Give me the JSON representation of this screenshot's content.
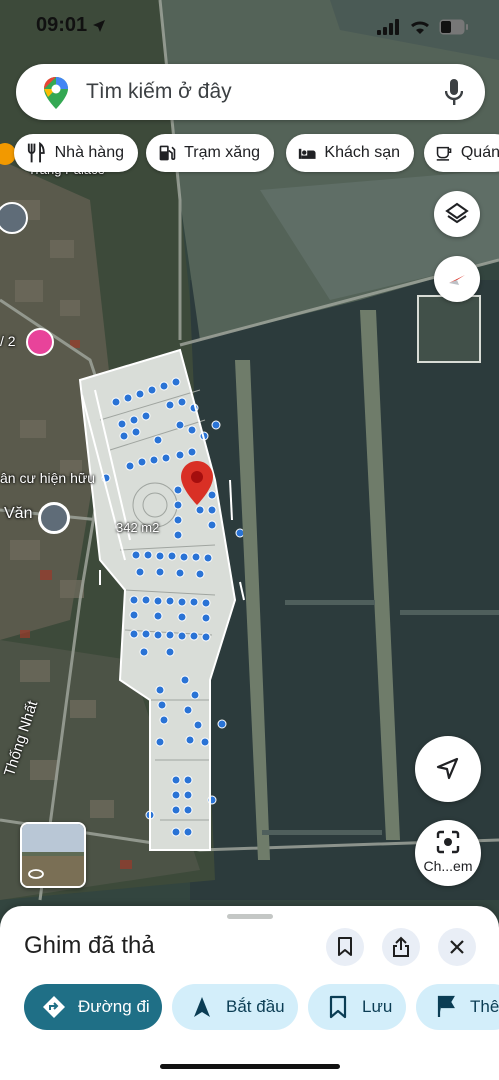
{
  "status_bar": {
    "time": "09:01",
    "icons": [
      "location-arrow-icon",
      "signal-icon",
      "wifi-icon",
      "battery-icon"
    ]
  },
  "search": {
    "placeholder": "Tìm kiếm ở đây",
    "logo": "maps-pin-logo",
    "mic_icon": "mic-icon"
  },
  "chips": [
    {
      "label": "Nhà hàng",
      "icon": "fork-knife-icon"
    },
    {
      "label": "Trạm xăng",
      "icon": "gas-station-icon"
    },
    {
      "label": "Khách sạn",
      "icon": "bed-icon"
    },
    {
      "label": "Quán",
      "icon": "coffee-icon"
    }
  ],
  "map": {
    "labels": {
      "place_1": "Trang Palace",
      "place_2": "ân cư hiện hữu",
      "place_3": "Văn",
      "area_measure": "342 m2",
      "street": "Thống Nhất",
      "place_4": "/ 2"
    },
    "dropped_pin_color": "#d93025"
  },
  "map_controls": {
    "layers_icon": "layers-icon",
    "compass_icon": "compass-icon",
    "location_icon": "my-location-icon",
    "lens_label": "Ch...em",
    "lens_icon": "lens-icon",
    "street_view_icon": "360-icon"
  },
  "sheet": {
    "title": "Ghim đã thả",
    "bookmark_icon": "bookmark-icon",
    "share_icon": "share-icon",
    "close_icon": "close-icon",
    "actions": [
      {
        "label": "Đường đi",
        "icon": "directions-icon",
        "style": "primary"
      },
      {
        "label": "Bắt đầu",
        "icon": "navigation-arrow-icon",
        "style": "secondary"
      },
      {
        "label": "Lưu",
        "icon": "bookmark-icon",
        "style": "secondary"
      },
      {
        "label": "Thêm",
        "icon": "flag-icon",
        "style": "secondary"
      }
    ]
  },
  "colors": {
    "primary_action": "#1f6f86",
    "secondary_action": "#d3eefa",
    "map_water": "#2f3d3f"
  }
}
